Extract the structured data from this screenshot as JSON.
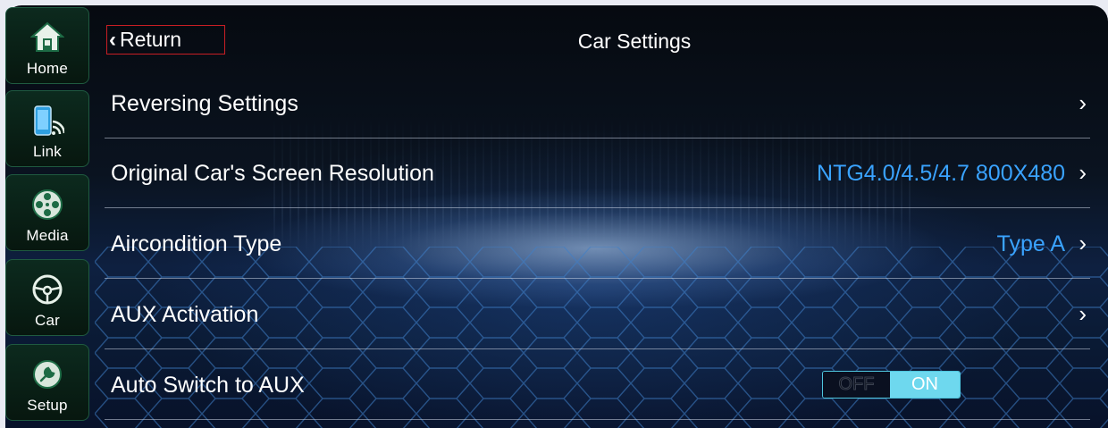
{
  "sidebar": {
    "items": [
      {
        "label": "Home",
        "icon": "home-icon"
      },
      {
        "label": "Link",
        "icon": "phone-link-icon"
      },
      {
        "label": "Media",
        "icon": "film-reel-icon"
      },
      {
        "label": "Car",
        "icon": "steering-wheel-icon"
      },
      {
        "label": "Setup",
        "icon": "settings-icon"
      }
    ]
  },
  "header": {
    "return_label": "Return",
    "return_chevron": "‹",
    "title": "Car Settings"
  },
  "settings": [
    {
      "label": "Reversing Settings",
      "value": "",
      "arrow": "›"
    },
    {
      "label": "Original Car's Screen Resolution",
      "value": "NTG4.0/4.5/4.7 800X480",
      "arrow": "›"
    },
    {
      "label": "Aircondition Type",
      "value": "Type A",
      "arrow": "›"
    },
    {
      "label": "AUX Activation",
      "value": "",
      "arrow": "›"
    },
    {
      "label": "Auto Switch to AUX",
      "toggle": {
        "off_label": "OFF",
        "on_label": "ON",
        "state": "ON"
      }
    }
  ],
  "colors": {
    "accent_value": "#3aa3ff",
    "toggle_on": "#6ed8ee",
    "return_border": "#c81e24",
    "sidebar_bg": "#0c2a1e"
  }
}
